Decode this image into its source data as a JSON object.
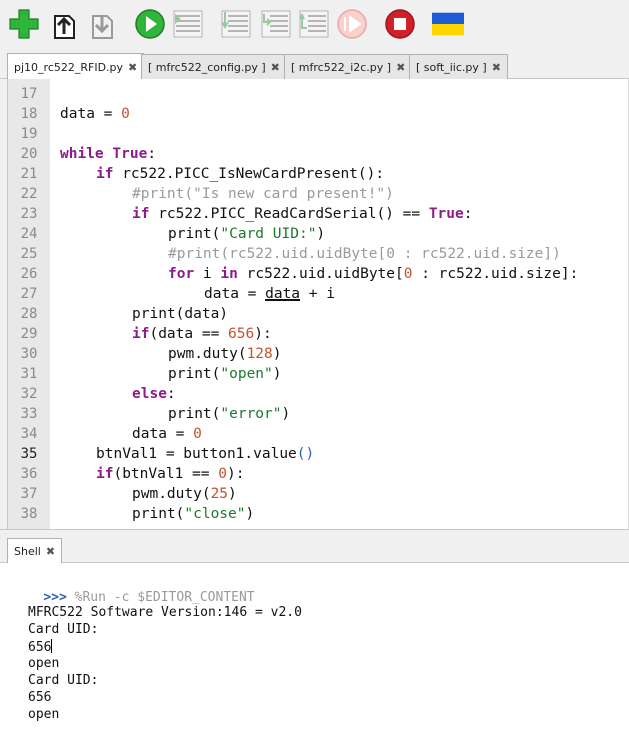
{
  "toolbar": {
    "buttons": [
      "new-file",
      "open-file",
      "save-file",
      "run",
      "debug",
      "step-over",
      "step-into",
      "step-out",
      "resume",
      "stop",
      "flag"
    ],
    "colors": {
      "green": "#2fb53a",
      "stop": "#d0202a",
      "flag_blue": "#1f5bd8",
      "flag_yellow": "#ffd500"
    }
  },
  "tabs": [
    {
      "label": "pj10_rc522_RFID.py",
      "active": true
    },
    {
      "label": "[ mfrc522_config.py ]",
      "active": false
    },
    {
      "label": "[ mfrc522_i2c.py ]",
      "active": false
    },
    {
      "label": "[ soft_iic.py ]",
      "active": false
    }
  ],
  "tab_close_glyph": "✖",
  "editor": {
    "current_line": 35,
    "lines": [
      {
        "n": "17",
        "indent": 0,
        "tokens": []
      },
      {
        "n": "18",
        "indent": 0,
        "tokens": [
          [
            "t",
            "data = "
          ],
          [
            "num",
            "0"
          ]
        ]
      },
      {
        "n": "19",
        "indent": 0,
        "tokens": []
      },
      {
        "n": "20",
        "indent": 0,
        "tokens": [
          [
            "kw",
            "while"
          ],
          [
            "t",
            " "
          ],
          [
            "kw",
            "True"
          ],
          [
            "t",
            ":"
          ]
        ]
      },
      {
        "n": "21",
        "indent": 1,
        "tokens": [
          [
            "kw",
            "if"
          ],
          [
            "t",
            " rc522.PICC_IsNewCardPresent():"
          ]
        ]
      },
      {
        "n": "22",
        "indent": 2,
        "tokens": [
          [
            "cmt",
            "#print(\"Is new card present!\")"
          ]
        ]
      },
      {
        "n": "23",
        "indent": 2,
        "tokens": [
          [
            "kw",
            "if"
          ],
          [
            "t",
            " rc522.PICC_ReadCardSerial() == "
          ],
          [
            "kw",
            "True"
          ],
          [
            "t",
            ":"
          ]
        ]
      },
      {
        "n": "24",
        "indent": 3,
        "tokens": [
          [
            "t",
            "print("
          ],
          [
            "str",
            "\"Card UID:\""
          ],
          [
            "t",
            ")"
          ]
        ]
      },
      {
        "n": "25",
        "indent": 3,
        "tokens": [
          [
            "cmt",
            "#print(rc522.uid.uidByte[0 : rc522.uid.size])"
          ]
        ]
      },
      {
        "n": "26",
        "indent": 3,
        "tokens": [
          [
            "kw",
            "for"
          ],
          [
            "t",
            " i "
          ],
          [
            "kw",
            "in"
          ],
          [
            "t",
            " rc522.uid.uidByte["
          ],
          [
            "num",
            "0"
          ],
          [
            "t",
            " : rc522.uid.size]:"
          ]
        ]
      },
      {
        "n": "27",
        "indent": 4,
        "tokens": [
          [
            "t",
            "data = "
          ],
          [
            "und",
            "data"
          ],
          [
            "t",
            " + i"
          ]
        ]
      },
      {
        "n": "28",
        "indent": 2,
        "tokens": [
          [
            "t",
            "print(data)"
          ]
        ]
      },
      {
        "n": "29",
        "indent": 2,
        "tokens": [
          [
            "kw",
            "if"
          ],
          [
            "t",
            "(data == "
          ],
          [
            "num",
            "656"
          ],
          [
            "t",
            "):"
          ]
        ]
      },
      {
        "n": "30",
        "indent": 3,
        "tokens": [
          [
            "t",
            "pwm.duty("
          ],
          [
            "num",
            "128"
          ],
          [
            "t",
            ")"
          ]
        ]
      },
      {
        "n": "31",
        "indent": 3,
        "tokens": [
          [
            "t",
            "print("
          ],
          [
            "str",
            "\"open\""
          ],
          [
            "t",
            ")"
          ]
        ]
      },
      {
        "n": "32",
        "indent": 2,
        "tokens": [
          [
            "kw",
            "else"
          ],
          [
            "t",
            ":"
          ]
        ]
      },
      {
        "n": "33",
        "indent": 3,
        "tokens": [
          [
            "t",
            "print("
          ],
          [
            "str",
            "\"error\""
          ],
          [
            "t",
            ")"
          ]
        ]
      },
      {
        "n": "34",
        "indent": 2,
        "tokens": [
          [
            "t",
            "data = "
          ],
          [
            "num",
            "0"
          ]
        ]
      },
      {
        "n": "35",
        "indent": 1,
        "tokens": [
          [
            "t",
            "btnVal1 = button1.value"
          ],
          [
            "blue",
            "()"
          ]
        ]
      },
      {
        "n": "36",
        "indent": 1,
        "tokens": [
          [
            "kw",
            "if"
          ],
          [
            "t",
            "(btnVal1 == "
          ],
          [
            "num",
            "0"
          ],
          [
            "t",
            "):"
          ]
        ]
      },
      {
        "n": "37",
        "indent": 2,
        "tokens": [
          [
            "t",
            "pwm.duty("
          ],
          [
            "num",
            "25"
          ],
          [
            "t",
            ")"
          ]
        ]
      },
      {
        "n": "38",
        "indent": 2,
        "tokens": [
          [
            "t",
            "print("
          ],
          [
            "str",
            "\"close\""
          ],
          [
            "t",
            ")"
          ]
        ]
      }
    ]
  },
  "shell": {
    "tab_label": "Shell",
    "prompt": ">>>",
    "command": " %Run -c $EDITOR_CONTENT",
    "output": [
      "MFRC522 Software Version:146 = v2.0",
      "Card UID:",
      "656",
      "open",
      "Card UID:",
      "656",
      "open"
    ]
  }
}
